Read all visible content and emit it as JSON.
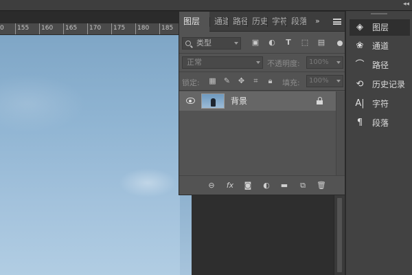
{
  "window": {
    "collapse_arrows": "◂◂"
  },
  "ruler": {
    "ticks": [
      "0",
      "155",
      "160",
      "165",
      "170",
      "175",
      "180",
      "185"
    ]
  },
  "layers_panel": {
    "tabs": [
      {
        "label": "图层",
        "active": true
      },
      {
        "label": "通道",
        "active": false
      },
      {
        "label": "路径",
        "active": false
      },
      {
        "label": "历史",
        "active": false
      },
      {
        "label": "字符",
        "active": false
      },
      {
        "label": "段落",
        "active": false
      }
    ],
    "overflow_label": "»",
    "filter": {
      "kind_label": "类型"
    },
    "blend_mode": "正常",
    "opacity_label": "不透明度:",
    "opacity_value": "100%",
    "lock_label": "锁定:",
    "fill_label": "填充:",
    "fill_value": "100%",
    "layers": [
      {
        "name": "背景",
        "visible": true,
        "locked": true
      }
    ]
  },
  "dock": {
    "items": [
      {
        "label": "图层",
        "icon": "layers-icon",
        "active": true
      },
      {
        "label": "通道",
        "icon": "channels-icon",
        "active": false
      },
      {
        "label": "路径",
        "icon": "paths-icon",
        "active": false
      },
      {
        "label": "历史记录",
        "icon": "history-icon",
        "active": false
      },
      {
        "label": "字符",
        "icon": "character-icon",
        "active": false
      },
      {
        "label": "段落",
        "icon": "paragraph-icon",
        "active": false
      }
    ]
  }
}
